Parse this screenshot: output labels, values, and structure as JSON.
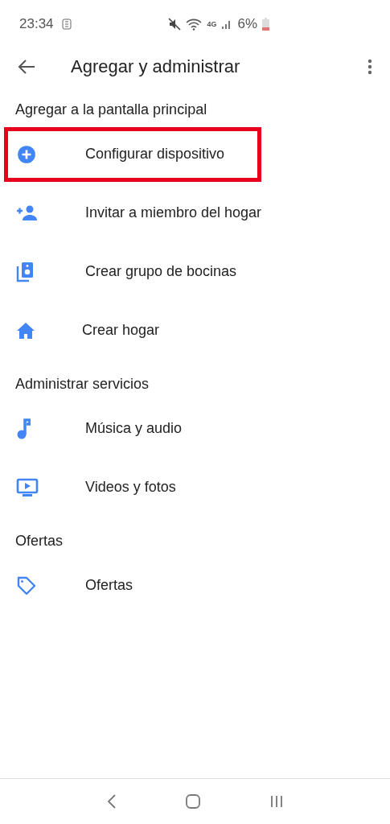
{
  "status_bar": {
    "time": "23:34",
    "battery": "6%",
    "network": "4G"
  },
  "header": {
    "title": "Agregar y administrar"
  },
  "sections": [
    {
      "title": "Agregar a la pantalla principal",
      "items": [
        {
          "label": "Configurar dispositivo",
          "kind": "add",
          "highlighted": true
        },
        {
          "label": "Invitar a miembro del hogar",
          "kind": "invite",
          "highlighted": false
        },
        {
          "label": "Crear grupo de bocinas",
          "kind": "speaker",
          "highlighted": false
        },
        {
          "label": "Crear hogar",
          "kind": "home",
          "highlighted": false
        }
      ]
    },
    {
      "title": "Administrar servicios",
      "items": [
        {
          "label": "Música y audio",
          "kind": "music",
          "highlighted": false
        },
        {
          "label": "Videos y fotos",
          "kind": "video",
          "highlighted": false
        }
      ]
    },
    {
      "title": "Ofertas",
      "items": [
        {
          "label": "Ofertas",
          "kind": "tag",
          "highlighted": false
        }
      ]
    }
  ]
}
